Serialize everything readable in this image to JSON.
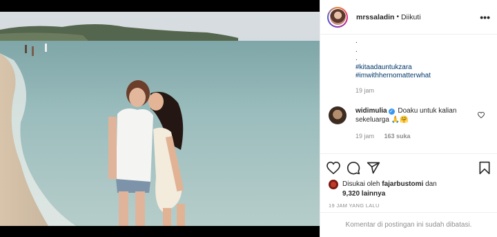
{
  "post": {
    "username": "mrssaladin",
    "follow_status": "Diikuti",
    "caption": {
      "dots": [
        ".",
        ".",
        "."
      ],
      "hashtags": [
        "#kitaadauntukzara",
        "#imwithhernomatterwhat"
      ],
      "time": "19 jam"
    },
    "comment": {
      "username": "widimulia",
      "text": "Doaku untuk kalian sekeluarga 🙏🤗",
      "time": "19 jam",
      "likes": "163 suka"
    },
    "likes": {
      "prefix": "Disukai oleh",
      "user": "fajarbustomi",
      "and": "dan",
      "others": "9,320 lainnya"
    },
    "timestamp": "19 JAM YANG LALU",
    "footer": "Komentar di postingan ini sudah dibatasi."
  },
  "icons": {
    "more": "more-options-icon",
    "verified": "verified-badge-icon",
    "like": "heart-icon",
    "comment": "comment-icon",
    "share": "share-icon",
    "save": "bookmark-icon"
  },
  "colors": {
    "hashtag": "#00376b",
    "muted": "#8e8e8e",
    "verified": "#3897f0",
    "border": "#efefef"
  }
}
